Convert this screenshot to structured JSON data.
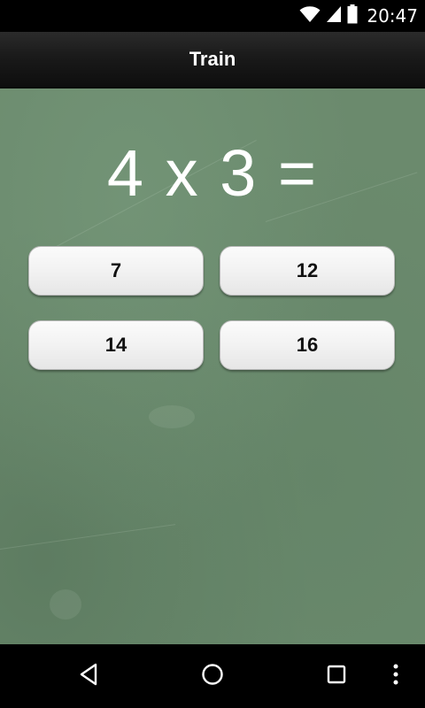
{
  "status_bar": {
    "time": "20:47",
    "icons": [
      "wifi-icon",
      "signal-icon",
      "battery-icon"
    ]
  },
  "action_bar": {
    "title": "Train"
  },
  "quiz": {
    "question": "4 x 3 =",
    "answers": [
      "7",
      "12",
      "14",
      "16"
    ]
  },
  "nav_bar": {
    "icons": [
      "back-icon",
      "home-icon",
      "recents-icon",
      "menu-icon"
    ]
  },
  "colors": {
    "board": "#6b8a6d",
    "status_bar": "#000000",
    "action_bar": "#1a1a1a",
    "button": "#f2f2f2"
  }
}
